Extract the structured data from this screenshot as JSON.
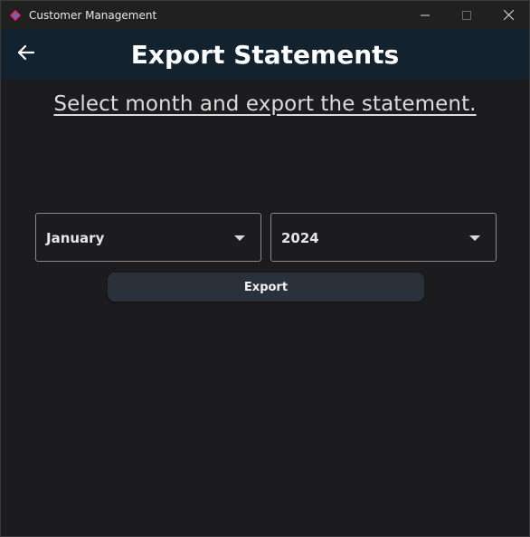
{
  "window": {
    "title": "Customer Management",
    "icon": "flutter-app-icon",
    "controls": [
      "minimize-icon",
      "maximize-icon",
      "close-icon"
    ]
  },
  "appbar": {
    "title": "Export Statements",
    "back_icon": "arrow-left-icon",
    "background": "#12232f"
  },
  "main": {
    "subtitle": "Select month and export the statement.",
    "month_dropdown": {
      "value": "January",
      "icon": "caret-down-icon"
    },
    "year_dropdown": {
      "value": "2024",
      "icon": "caret-down-icon"
    },
    "export_label": "Export"
  },
  "colors": {
    "background": "#1c1c1e",
    "button": "#2b313b",
    "accent_icon": "#e1306c"
  }
}
